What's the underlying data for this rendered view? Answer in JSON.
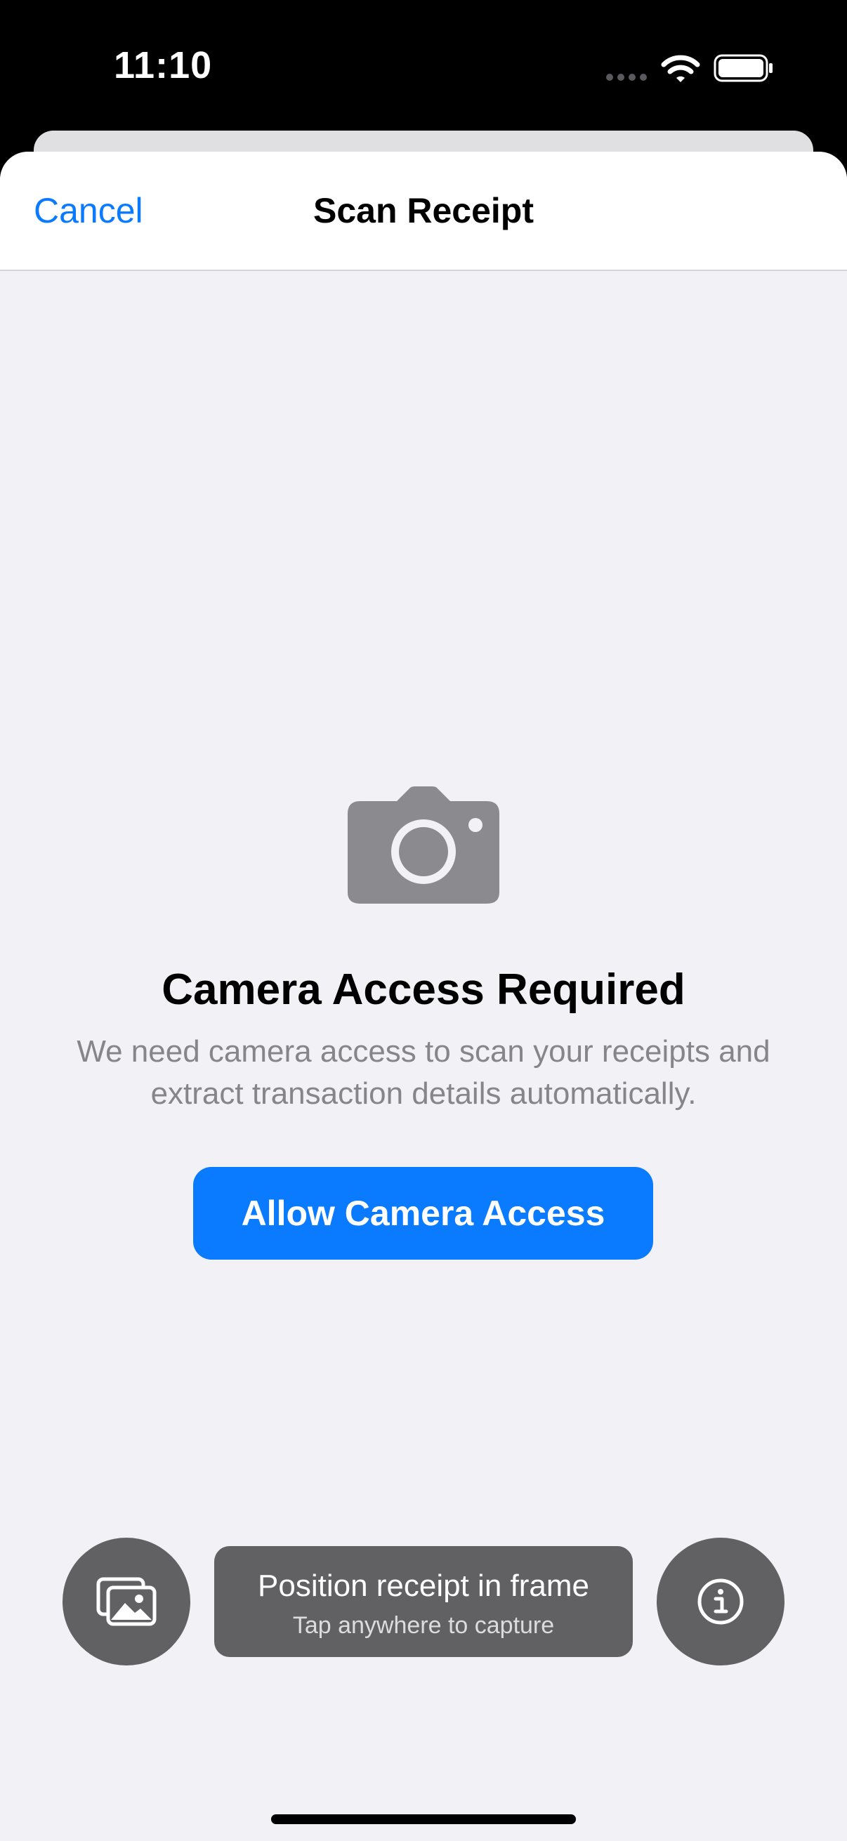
{
  "status_bar": {
    "time": "11:10",
    "icons": [
      "cellular-signal-icon",
      "wifi-icon",
      "battery-icon"
    ]
  },
  "nav": {
    "cancel_label": "Cancel",
    "title": "Scan Receipt"
  },
  "permission": {
    "icon": "camera-icon",
    "headline": "Camera Access Required",
    "description": "We need camera access to scan your receipts and extract transaction details automatically.",
    "allow_button_label": "Allow Camera Access"
  },
  "bottom_controls": {
    "gallery_icon": "photo-library-icon",
    "hint_title": "Position receipt in frame",
    "hint_subtitle": "Tap anywhere to capture",
    "info_icon": "info-icon"
  },
  "colors": {
    "accent": "#0a7aff",
    "sheet_background": "#f1f1f6",
    "icon_gray": "#8a8a8f",
    "overlay_gray": "#616163"
  }
}
